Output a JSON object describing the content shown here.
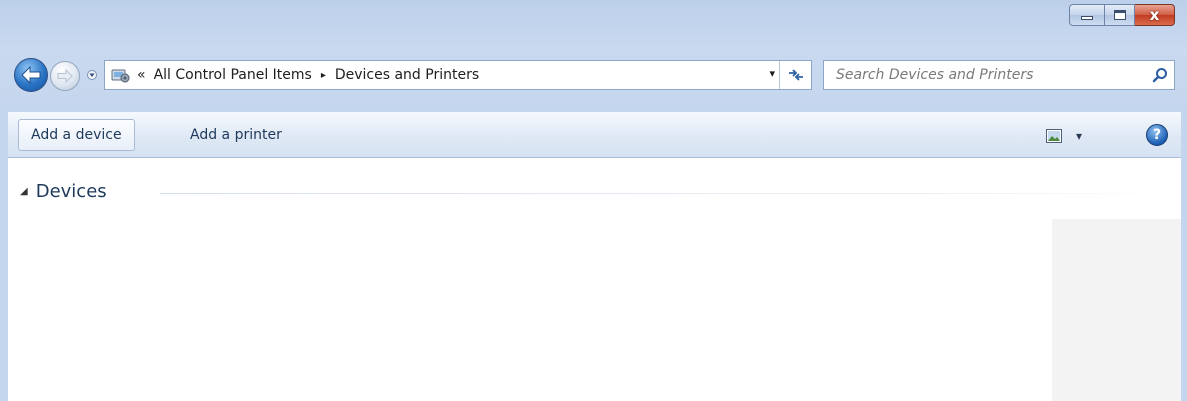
{
  "window": {
    "caption": {
      "minimize_icon": "minimize-icon",
      "maximize_icon": "maximize-icon",
      "close_label": "x"
    }
  },
  "nav": {
    "back_icon": "back-arrow-icon",
    "forward_icon": "forward-arrow-icon",
    "history_icon": "chevron-down-icon"
  },
  "address": {
    "overflow": "«",
    "crumbs": [
      "All Control Panel Items",
      "Devices and Printers"
    ],
    "crumb_separator": "▸",
    "dropdown": "▾",
    "refresh": "⇆"
  },
  "search": {
    "placeholder": "Search Devices and Printers"
  },
  "toolbar": {
    "add_device": "Add a device",
    "add_printer": "Add a printer",
    "view_dropdown": "▾",
    "help": "?"
  },
  "content": {
    "group_toggle": "◢",
    "group_title": "Devices"
  },
  "colors": {
    "frame": "#c4d6ee",
    "close_button": "#c23b22",
    "link_text": "#1e395b"
  }
}
